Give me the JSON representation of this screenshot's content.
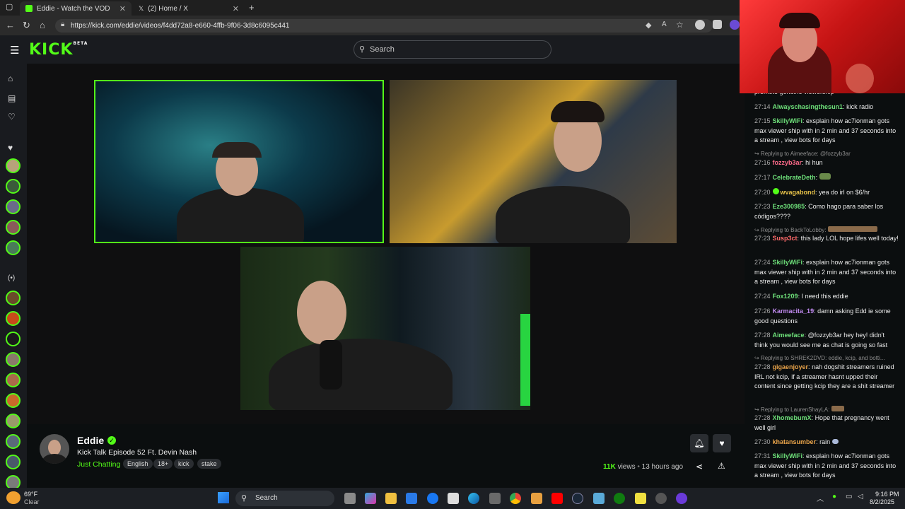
{
  "browser": {
    "tabs": [
      {
        "label": "Eddie - Watch the VOD on K"
      },
      {
        "label": "(2) Home / X"
      }
    ],
    "url": "https://kick.com/eddie/videos/f4dd72a8-e660-4ffb-9f06-3d8c6095c441"
  },
  "header": {
    "logo": "KICK",
    "logo_badge": "BETA",
    "search_placeholder": "Search"
  },
  "channel": {
    "name": "Eddie",
    "title": "Kick Talk Episode 52 Ft. Devin Nash",
    "category": "Just Chatting",
    "tags": [
      "English",
      "18+",
      "kick",
      "stake"
    ],
    "views_count": "11K",
    "views_label": "views",
    "time_ago": "13 hours ago"
  },
  "chat": [
    {
      "type": "text",
      "text": "promote genuine viewership"
    },
    {
      "time": "27:14",
      "user": "Alwayschasingthesun1",
      "color": "#6ee07a",
      "text": "kick radio"
    },
    {
      "time": "27:15",
      "user": "SkillyWiFi",
      "color": "#6ee07a",
      "text": "exsplain how ac7ionman gots max viewer ship with in 2 min and 37 seconds into a stream , view bots for days"
    },
    {
      "reply": "Replying to Aimeeface: @fozzyb3ar"
    },
    {
      "time": "27:16",
      "user": "fozzyb3ar",
      "color": "#ff6b8a",
      "text": "hi hun"
    },
    {
      "time": "27:17",
      "user": "CelebrateDeth",
      "color": "#6ee07a",
      "text": ""
    },
    {
      "time": "27:20",
      "user": "wvagabond",
      "color": "#e8c34a",
      "text": "yea do irl on $6/hr"
    },
    {
      "time": "27:23",
      "user": "Eze300985",
      "color": "#6ee07a",
      "text": "Como hago para saber los códigos????"
    },
    {
      "reply": "Replying to BackToLobby:"
    },
    {
      "time": "27:23",
      "user": "Susp3ct",
      "color": "#ff6b6b",
      "text": "this lady LOL hope lifes well today!"
    },
    {
      "time": "27:24",
      "user": "SkillyWiFi",
      "color": "#6ee07a",
      "text": "exsplain how ac7ionman gots max viewer ship with in 2 min and 37 seconds into a stream , view bots for days"
    },
    {
      "time": "27:24",
      "user": "Fox1209",
      "color": "#6ee07a",
      "text": "I need this eddie"
    },
    {
      "time": "27:26",
      "user": "Karmacita_19",
      "color": "#c08af0",
      "text": "damn asking Edd ie some good questions"
    },
    {
      "time": "27:28",
      "user": "Aimeeface",
      "color": "#6ee07a",
      "text": "@fozzyb3ar hey hey! didn't think you would see me as chat is going so fast"
    },
    {
      "reply": "Replying to SHREK2DVD: eddie, kcip, and botti..."
    },
    {
      "time": "27:28",
      "user": "gigaenjoyer",
      "color": "#e8a34a",
      "text": "nah dogshit streamers ruined IRL not kcip, if a streamer hasnt upped their content since getting kcip they are a shit streamer"
    },
    {
      "reply": "Replying to LaurenShayLA:"
    },
    {
      "time": "27:28",
      "user": "XhomebumX",
      "color": "#6ee07a",
      "text": "Hope that pregnancy went well girl"
    },
    {
      "time": "27:30",
      "user": "khatansumber",
      "color": "#e8a34a",
      "text": "rain"
    },
    {
      "time": "27:31",
      "user": "SkillyWiFi",
      "color": "#6ee07a",
      "text": "exsplain how ac7ionman gots max viewer ship with in 2 min and 37 seconds into a stream , view bots for days"
    }
  ],
  "taskbar": {
    "temp": "69°F",
    "condition": "Clear",
    "search": "Search",
    "time": "9:16 PM",
    "date": "8/2/2025"
  }
}
